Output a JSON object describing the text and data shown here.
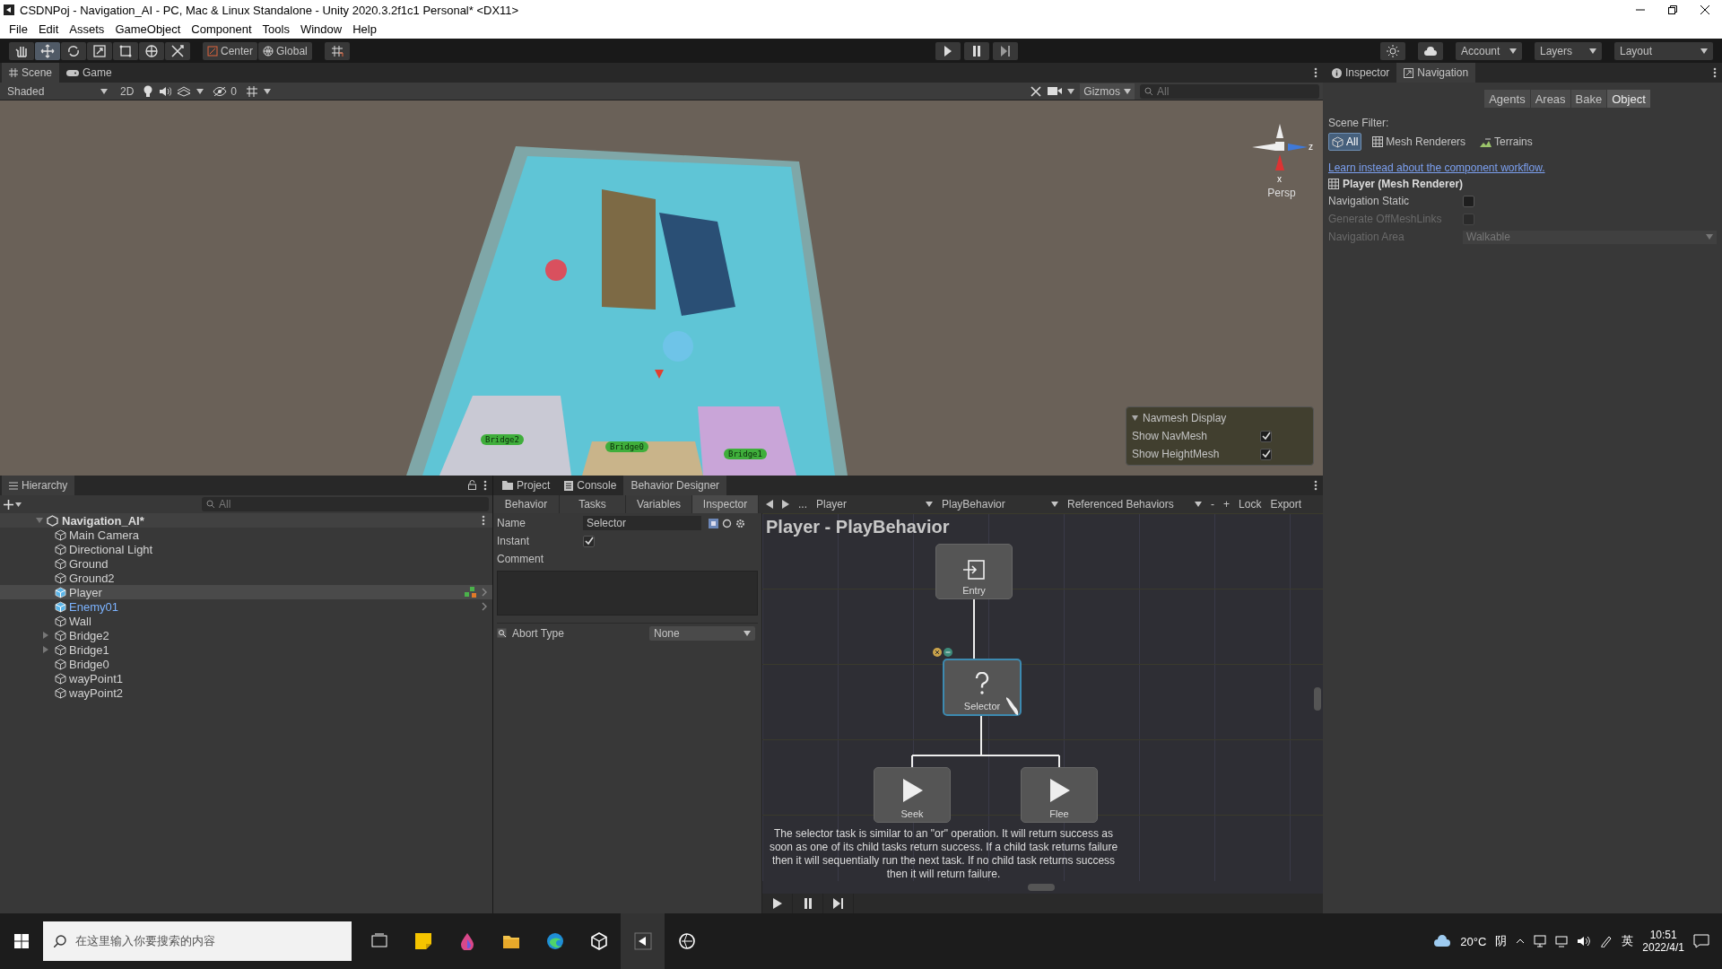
{
  "window": {
    "title": "CSDNPoj - Navigation_AI - PC, Mac & Linux Standalone - Unity 2020.3.2f1c1 Personal* <DX11>"
  },
  "menu": [
    "File",
    "Edit",
    "Assets",
    "GameObject",
    "Component",
    "Tools",
    "Window",
    "Help"
  ],
  "toolbar": {
    "tools": [
      {
        "kind": "hand",
        "selected": false
      },
      {
        "kind": "move",
        "selected": true
      },
      {
        "kind": "rotate",
        "selected": false
      },
      {
        "kind": "scale",
        "selected": false
      },
      {
        "kind": "rect",
        "selected": false
      },
      {
        "kind": "transform",
        "selected": false
      },
      {
        "kind": "custom",
        "selected": false
      }
    ],
    "pivot": "Center",
    "space": "Global",
    "account": "Account",
    "layers": "Layers",
    "layout": "Layout"
  },
  "scene_panel": {
    "tabs": [
      {
        "label": "Scene",
        "kind": "scene",
        "selected": true
      },
      {
        "label": "Game",
        "kind": "game",
        "selected": false
      }
    ],
    "shading": "Shaded",
    "mode_2d": "2D",
    "hidden_count": "0",
    "gizmos": "Gizmos",
    "search": {
      "placeholder": "All"
    },
    "axis_labels": [
      "z",
      "x"
    ],
    "projection": "Persp",
    "bridge_labels": [
      "Bridge2",
      "Bridge0",
      "Bridge1"
    ],
    "navmesh_display": {
      "title": "Navmesh Display",
      "options": [
        {
          "label": "Show NavMesh",
          "checked": true
        },
        {
          "label": "Show HeightMesh",
          "checked": true
        }
      ]
    }
  },
  "inspector": {
    "tabs": [
      {
        "label": "Inspector",
        "kind": "info",
        "selected": false
      },
      {
        "label": "Navigation",
        "kind": "navigation",
        "selected": true
      }
    ],
    "modes": [
      {
        "label": "Agents",
        "selected": false
      },
      {
        "label": "Areas",
        "selected": false
      },
      {
        "label": "Bake",
        "selected": false
      },
      {
        "label": "Object",
        "selected": true
      }
    ],
    "scene_filter_label": "Scene Filter:",
    "filters": [
      {
        "label": "All",
        "kind": "cube",
        "selected": true
      },
      {
        "label": "Mesh Renderers",
        "kind": "mesh",
        "selected": false
      },
      {
        "label": "Terrains",
        "kind": "terrain",
        "selected": false
      }
    ],
    "link": "Learn instead about the component workflow.",
    "object_title": "Player (Mesh Renderer)",
    "fields": [
      {
        "label": "Navigation Static",
        "kind": "checkbox",
        "checked": false,
        "disabled": false
      },
      {
        "label": "Generate OffMeshLinks",
        "kind": "checkbox",
        "checked": false,
        "disabled": true
      },
      {
        "label": "Navigation Area",
        "kind": "dropdown",
        "value": "Walkable",
        "disabled": true
      }
    ]
  },
  "hierarchy": {
    "title": "Hierarchy",
    "search": {
      "placeholder": "All"
    },
    "scene": "Navigation_AI*",
    "items": [
      {
        "label": "Main Camera",
        "kind": "object",
        "selected": false,
        "expandable": false,
        "has_behavior": false
      },
      {
        "label": "Directional Light",
        "kind": "object",
        "selected": false,
        "expandable": false,
        "has_behavior": false
      },
      {
        "label": "Ground",
        "kind": "object",
        "selected": false,
        "expandable": false,
        "has_behavior": false
      },
      {
        "label": "Ground2",
        "kind": "object",
        "selected": false,
        "expandable": false,
        "has_behavior": false
      },
      {
        "label": "Player",
        "kind": "prefab",
        "selected": true,
        "expandable": false,
        "has_behavior": true
      },
      {
        "label": "Enemy01",
        "kind": "prefab",
        "selected": false,
        "expandable": false,
        "has_behavior": false
      },
      {
        "label": "Wall",
        "kind": "object",
        "selected": false,
        "expandable": false,
        "has_behavior": false
      },
      {
        "label": "Bridge2",
        "kind": "object",
        "selected": false,
        "expandable": true,
        "has_behavior": false
      },
      {
        "label": "Bridge1",
        "kind": "object",
        "selected": false,
        "expandable": true,
        "has_behavior": false
      },
      {
        "label": "Bridge0",
        "kind": "object",
        "selected": false,
        "expandable": false,
        "has_behavior": false
      },
      {
        "label": "wayPoint1",
        "kind": "object",
        "selected": false,
        "expandable": false,
        "has_behavior": false
      },
      {
        "label": "wayPoint2",
        "kind": "object",
        "selected": false,
        "expandable": false,
        "has_behavior": false
      }
    ]
  },
  "designer": {
    "tabs": [
      {
        "label": "Project",
        "kind": "folder",
        "selected": false
      },
      {
        "label": "Console",
        "kind": "console",
        "selected": false
      },
      {
        "label": "Behavior Designer",
        "kind": "plain",
        "selected": true
      }
    ],
    "subtabs": [
      {
        "label": "Behavior",
        "selected": false
      },
      {
        "label": "Tasks",
        "selected": false
      },
      {
        "label": "Variables",
        "selected": false
      },
      {
        "label": "Inspector",
        "selected": true
      }
    ],
    "nav": {
      "more": "...",
      "object": "Player",
      "behavior": "PlayBehavior",
      "referenced": "Referenced Behaviors",
      "minus": "-",
      "plus": "+",
      "lock": "Lock",
      "export": "Export"
    },
    "task": {
      "name_label": "Name",
      "name": "Selector",
      "instant_label": "Instant",
      "instant": true,
      "comment_label": "Comment",
      "abort_label": "Abort Type",
      "abort": "None"
    },
    "graph": {
      "title": "Player - PlayBehavior",
      "nodes": [
        {
          "label": "Entry",
          "kind": "entry",
          "selected": false
        },
        {
          "label": "Selector",
          "kind": "selector",
          "selected": true
        },
        {
          "label": "Seek",
          "kind": "action",
          "selected": false
        },
        {
          "label": "Flee",
          "kind": "action",
          "selected": false
        }
      ],
      "description": "The selector task is similar to an \"or\" operation. It will return success as soon as one of its child tasks return success. If a child task returns failure then it will sequentially run the next task. If no child task returns success then it will return failure."
    }
  },
  "taskbar": {
    "search": {
      "placeholder": "在这里输入你要搜索的内容"
    },
    "weather": "20°C",
    "condition": "阴",
    "ime": "英",
    "time": "10:51",
    "date": "2022/4/1"
  }
}
